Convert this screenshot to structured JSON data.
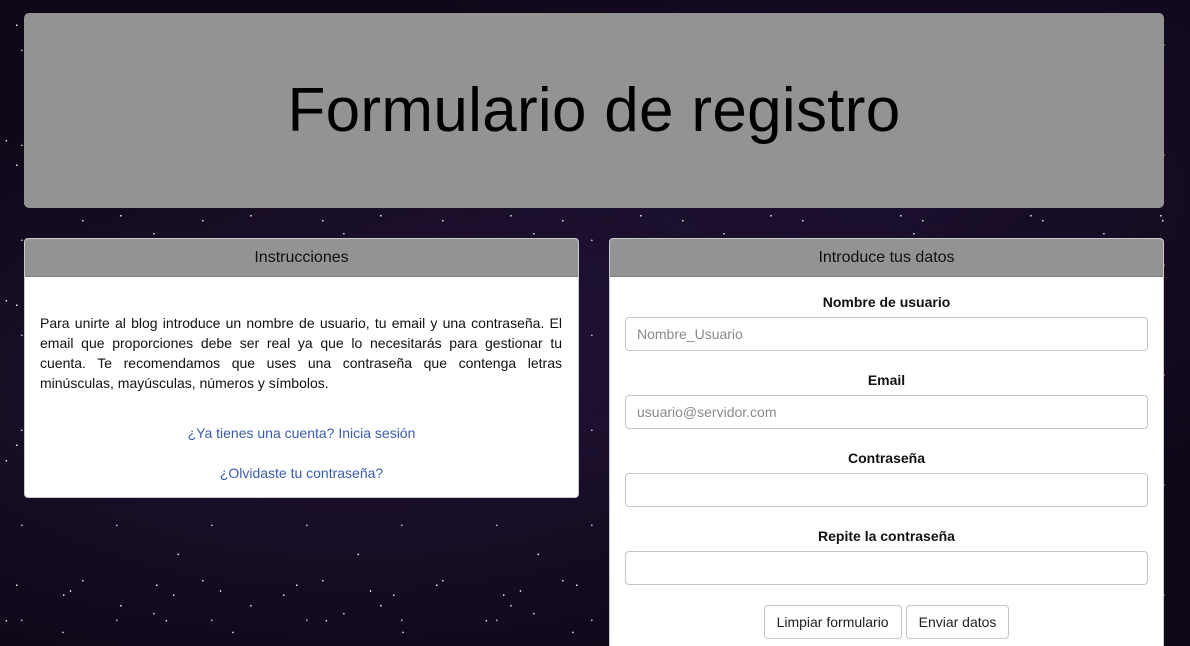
{
  "header": {
    "title": "Formulario de registro"
  },
  "instructions": {
    "title": "Instrucciones",
    "text": "Para unirte al blog introduce un nombre de usuario, tu email y una contraseña. El email que proporciones debe ser real ya que lo necesitarás para gestionar tu cuenta. Te recomendamos que uses una contraseña que contenga letras minúsculas, mayúsculas, números y símbolos.",
    "login_link": "¿Ya tienes una cuenta? Inicia sesión",
    "forgot_link": "¿Olvidaste tu contraseña?"
  },
  "form": {
    "title": "Introduce tus datos",
    "fields": [
      {
        "label": "Nombre de usuario",
        "placeholder": "Nombre_Usuario",
        "value": ""
      },
      {
        "label": "Email",
        "placeholder": "usuario@servidor.com",
        "value": ""
      },
      {
        "label": "Contraseña",
        "placeholder": "",
        "value": ""
      },
      {
        "label": "Repite la contraseña",
        "placeholder": "",
        "value": ""
      }
    ],
    "reset_button": "Limpiar formulario",
    "submit_button": "Enviar datos"
  },
  "colors": {
    "header_bg": "#939393",
    "link": "#3b5cad",
    "background": "#0d0716"
  }
}
